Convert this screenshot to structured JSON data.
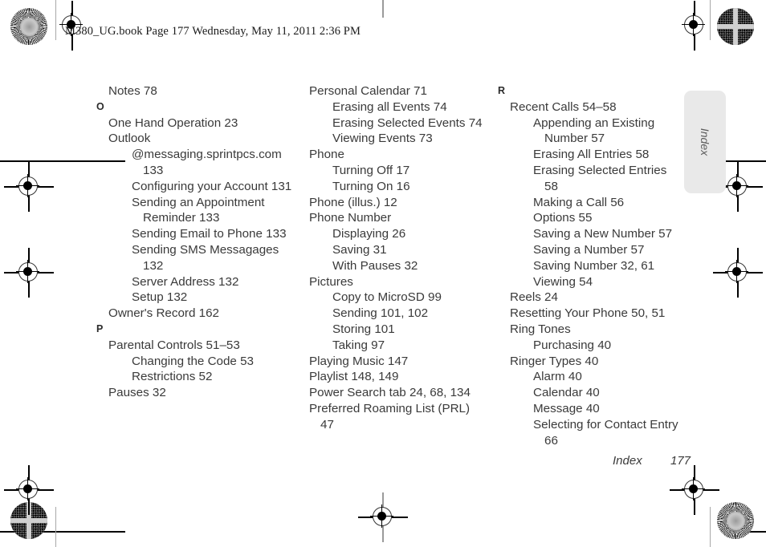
{
  "header": {
    "running_header": "M380_UG.book  Page 177  Wednesday, May 11, 2011  2:36 PM"
  },
  "side_tab": {
    "label": "Index",
    "background_color": "#e9e9e9",
    "text_color": "#5d5d5d"
  },
  "footer": {
    "section_label": "Index",
    "page_number": "177"
  },
  "columns": [
    {
      "id": "column-1",
      "blocks": [
        {
          "type": "entry",
          "level": 1,
          "text": "Notes 78"
        },
        {
          "type": "letter",
          "text": "O"
        },
        {
          "type": "entry",
          "level": 1,
          "text": "One Hand Operation 23"
        },
        {
          "type": "entry",
          "level": 1,
          "text": "Outlook"
        },
        {
          "type": "entry",
          "level": 2,
          "text": "@messaging.sprintpcs.com 133"
        },
        {
          "type": "entry",
          "level": 2,
          "text": "Configuring your Account 131"
        },
        {
          "type": "entry",
          "level": 2,
          "text": "Sending an Appointment Reminder 133"
        },
        {
          "type": "entry",
          "level": 2,
          "text": "Sending Email to Phone 133"
        },
        {
          "type": "entry",
          "level": 2,
          "text": "Sending SMS Messagages 132"
        },
        {
          "type": "entry",
          "level": 2,
          "text": "Server Address 132"
        },
        {
          "type": "entry",
          "level": 2,
          "text": "Setup 132"
        },
        {
          "type": "entry",
          "level": 1,
          "text": "Owner's Record 162"
        },
        {
          "type": "letter",
          "text": "P"
        },
        {
          "type": "entry",
          "level": 1,
          "text": "Parental Controls 51–53"
        },
        {
          "type": "entry",
          "level": 2,
          "text": "Changing the Code 53"
        },
        {
          "type": "entry",
          "level": 2,
          "text": "Restrictions 52"
        },
        {
          "type": "entry",
          "level": 1,
          "text": "Pauses 32"
        }
      ]
    },
    {
      "id": "column-2",
      "blocks": [
        {
          "type": "entry",
          "level": 1,
          "text": "Personal Calendar 71"
        },
        {
          "type": "entry",
          "level": 2,
          "text": "Erasing all Events 74"
        },
        {
          "type": "entry",
          "level": 2,
          "text": "Erasing Selected Events 74"
        },
        {
          "type": "entry",
          "level": 2,
          "text": "Viewing Events 73"
        },
        {
          "type": "entry",
          "level": 1,
          "text": "Phone"
        },
        {
          "type": "entry",
          "level": 2,
          "text": "Turning Off 17"
        },
        {
          "type": "entry",
          "level": 2,
          "text": "Turning On 16"
        },
        {
          "type": "entry",
          "level": 1,
          "text": "Phone (illus.) 12"
        },
        {
          "type": "entry",
          "level": 1,
          "text": "Phone Number"
        },
        {
          "type": "entry",
          "level": 2,
          "text": "Displaying 26"
        },
        {
          "type": "entry",
          "level": 2,
          "text": "Saving 31"
        },
        {
          "type": "entry",
          "level": 2,
          "text": "With Pauses 32"
        },
        {
          "type": "entry",
          "level": 1,
          "text": "Pictures"
        },
        {
          "type": "entry",
          "level": 2,
          "text": "Copy to MicroSD 99"
        },
        {
          "type": "entry",
          "level": 2,
          "text": "Sending 101, 102"
        },
        {
          "type": "entry",
          "level": 2,
          "text": "Storing 101"
        },
        {
          "type": "entry",
          "level": 2,
          "text": "Taking 97"
        },
        {
          "type": "entry",
          "level": 1,
          "text": "Playing Music 147"
        },
        {
          "type": "entry",
          "level": 1,
          "text": "Playlist 148, 149"
        },
        {
          "type": "entry",
          "level": 1,
          "text": "Power Search tab 24, 68, 134"
        },
        {
          "type": "entry",
          "level": 1,
          "text": "Preferred Roaming List (PRL) 47"
        }
      ]
    },
    {
      "id": "column-3",
      "blocks": [
        {
          "type": "letter",
          "text": "R"
        },
        {
          "type": "entry",
          "level": 1,
          "text": "Recent Calls 54–58"
        },
        {
          "type": "entry",
          "level": 2,
          "text": "Appending an Existing Number 57"
        },
        {
          "type": "entry",
          "level": 2,
          "text": "Erasing All Entries 58"
        },
        {
          "type": "entry",
          "level": 2,
          "text": "Erasing Selected Entries 58"
        },
        {
          "type": "entry",
          "level": 2,
          "text": "Making a Call 56"
        },
        {
          "type": "entry",
          "level": 2,
          "text": "Options 55"
        },
        {
          "type": "entry",
          "level": 2,
          "text": "Saving a New Number 57"
        },
        {
          "type": "entry",
          "level": 2,
          "text": "Saving a Number 57"
        },
        {
          "type": "entry",
          "level": 2,
          "text": "Saving Number 32, 61"
        },
        {
          "type": "entry",
          "level": 2,
          "text": "Viewing 54"
        },
        {
          "type": "entry",
          "level": 1,
          "text": "Reels 24"
        },
        {
          "type": "entry",
          "level": 1,
          "text": "Resetting Your Phone 50, 51"
        },
        {
          "type": "entry",
          "level": 1,
          "text": "Ring Tones"
        },
        {
          "type": "entry",
          "level": 2,
          "text": "Purchasing 40"
        },
        {
          "type": "entry",
          "level": 1,
          "text": "Ringer Types 40"
        },
        {
          "type": "entry",
          "level": 2,
          "text": "Alarm 40"
        },
        {
          "type": "entry",
          "level": 2,
          "text": "Calendar 40"
        },
        {
          "type": "entry",
          "level": 2,
          "text": "Message 40"
        },
        {
          "type": "entry",
          "level": 2,
          "text": "Selecting for Contact Entry 66"
        }
      ]
    }
  ],
  "print_marks": {
    "rosette_top_left": "starburst-rosette",
    "rosette_top_right": "maze-rosette",
    "rosette_bottom_left": "maze-rosette",
    "rosette_bottom_right": "starburst-rosette"
  }
}
